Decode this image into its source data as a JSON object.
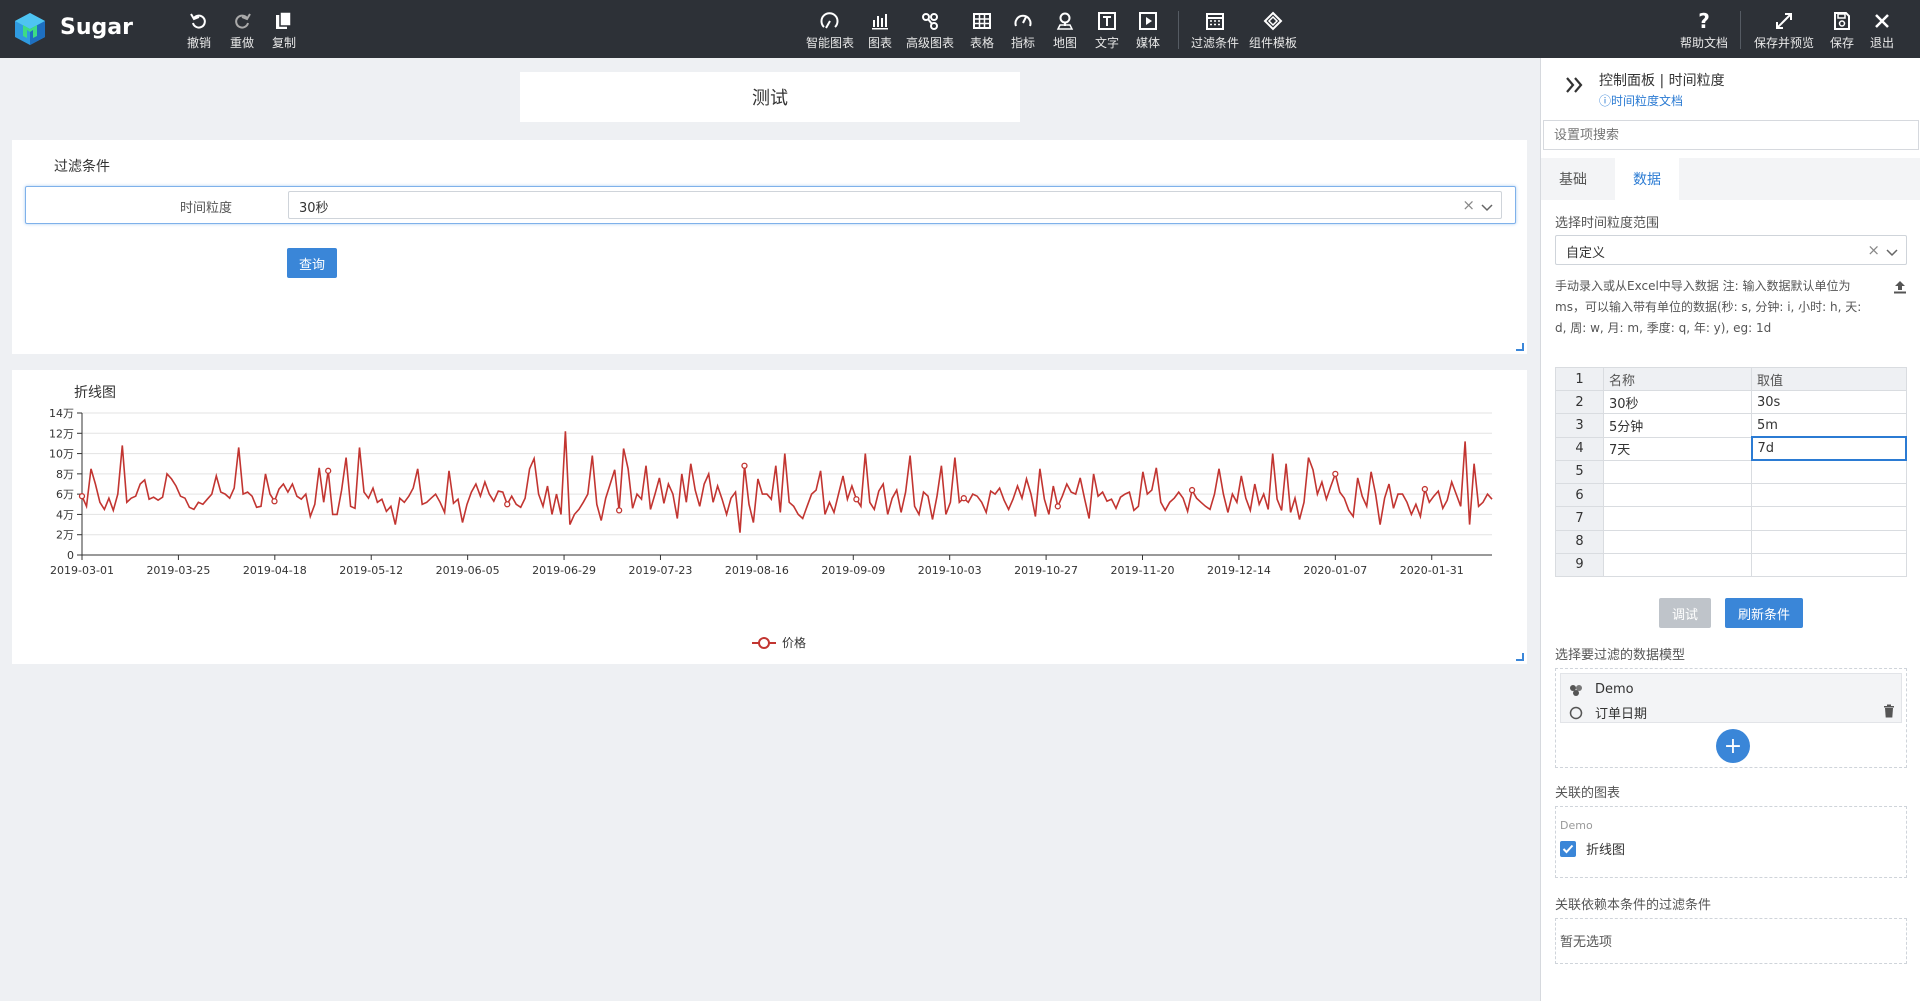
{
  "app": {
    "name": "Sugar"
  },
  "toolbar": {
    "left": [
      {
        "name": "undo",
        "label": "撤销"
      },
      {
        "name": "redo",
        "label": "重做"
      },
      {
        "name": "copy",
        "label": "复制"
      }
    ],
    "center": [
      {
        "name": "smart-chart",
        "label": "智能图表"
      },
      {
        "name": "chart",
        "label": "图表"
      },
      {
        "name": "advanced-chart",
        "label": "高级图表"
      },
      {
        "name": "table",
        "label": "表格"
      },
      {
        "name": "metric",
        "label": "指标"
      },
      {
        "name": "map",
        "label": "地图"
      },
      {
        "name": "text",
        "label": "文字"
      },
      {
        "name": "media",
        "label": "媒体"
      },
      {
        "name": "filter",
        "label": "过滤条件"
      },
      {
        "name": "component-template",
        "label": "组件模板"
      }
    ],
    "right": [
      {
        "name": "help",
        "label": "帮助文档"
      },
      {
        "name": "save-preview",
        "label": "保存并预览"
      },
      {
        "name": "save",
        "label": "保存"
      },
      {
        "name": "exit",
        "label": "退出"
      }
    ]
  },
  "canvas": {
    "title": "测试",
    "filter_card": {
      "title": "过滤条件",
      "field_label": "时间粒度",
      "field_value": "30秒",
      "clear_glyph": "×",
      "query_label": "查询"
    },
    "chart_card": {
      "title": "折线图"
    }
  },
  "chart_data": {
    "type": "line",
    "title": "折线图",
    "xlabel": "",
    "ylabel": "",
    "ylim": [
      0,
      140000
    ],
    "y_ticks": [
      0,
      20000,
      40000,
      60000,
      80000,
      100000,
      120000,
      140000
    ],
    "y_tick_labels": [
      "0",
      "2万",
      "4万",
      "6万",
      "8万",
      "10万",
      "12万",
      "14万"
    ],
    "x_tick_labels": [
      "2019-03-01",
      "2019-03-25",
      "2019-04-18",
      "2019-05-12",
      "2019-06-05",
      "2019-06-29",
      "2019-07-23",
      "2019-08-16",
      "2019-09-09",
      "2019-10-03",
      "2019-10-27",
      "2019-11-20",
      "2019-12-14",
      "2020-01-07",
      "2020-01-31"
    ],
    "x_range": [
      "2019-03-01",
      "2020-02-15"
    ],
    "grid": true,
    "legend": "bottom",
    "line_color": "#c23531",
    "series": [
      {
        "name": "价格",
        "values": [
          58000,
          48000,
          85000,
          70000,
          52000,
          45000,
          56000,
          44000,
          60000,
          108000,
          52000,
          56000,
          58000,
          70000,
          74000,
          55000,
          57000,
          54000,
          57000,
          80000,
          75000,
          68000,
          58000,
          56000,
          47000,
          45000,
          52000,
          50000,
          55000,
          60000,
          78000,
          62000,
          60000,
          56000,
          66000,
          106000,
          60000,
          62000,
          58000,
          47000,
          48000,
          80000,
          60000,
          53000,
          65000,
          70000,
          62000,
          70000,
          58000,
          55000,
          60000,
          38000,
          50000,
          86000,
          52000,
          83000,
          40000,
          40000,
          64000,
          96000,
          48000,
          46000,
          106000,
          62000,
          56000,
          66000,
          52000,
          55000,
          43000,
          48000,
          30000,
          56000,
          52000,
          58000,
          66000,
          85000,
          50000,
          52000,
          56000,
          60000,
          52000,
          42000,
          83000,
          51000,
          55000,
          32000,
          50000,
          62000,
          70000,
          58000,
          72000,
          60000,
          53000,
          63000,
          62000,
          50000,
          58000,
          50000,
          47000,
          56000,
          85000,
          95000,
          60000,
          48000,
          68000,
          40000,
          60000,
          40000,
          122000,
          30000,
          40000,
          45000,
          52000,
          60000,
          98000,
          50000,
          34000,
          56000,
          70000,
          84000,
          44000,
          105000,
          85000,
          46000,
          60000,
          55000,
          88000,
          45000,
          60000,
          76000,
          51000,
          70000,
          60000,
          36000,
          80000,
          52000,
          90000,
          64000,
          48000,
          70000,
          80000,
          52000,
          68000,
          55000,
          40000,
          56000,
          62000,
          22000,
          88000,
          50000,
          32000,
          75000,
          60000,
          60000,
          55000,
          88000,
          42000,
          100000,
          52000,
          48000,
          40000,
          36000,
          48000,
          60000,
          64000,
          83000,
          40000,
          52000,
          42000,
          60000,
          78000,
          55000,
          68000,
          55000,
          48000,
          100000,
          52000,
          45000,
          63000,
          70000,
          40000,
          56000,
          64000,
          42000,
          62000,
          98000,
          48000,
          40000,
          62000,
          58000,
          35000,
          58000,
          88000,
          40000,
          52000,
          96000,
          52000,
          56000,
          52000,
          60000,
          58000,
          52000,
          42000,
          63000,
          60000,
          66000,
          54000,
          45000,
          55000,
          68000,
          56000,
          75000,
          60000,
          38000,
          85000,
          55000,
          40000,
          68000,
          48000,
          58000,
          70000,
          62000,
          60000,
          76000,
          55000,
          36000,
          80000,
          58000,
          62000,
          53000,
          55000,
          46000,
          57000,
          60000,
          62000,
          44000,
          48000,
          82000,
          60000,
          64000,
          86000,
          52000,
          44000,
          52000,
          56000,
          62000,
          56000,
          43000,
          64000,
          56000,
          52000,
          48000,
          45000,
          60000,
          85000,
          60000,
          42000,
          60000,
          52000,
          78000,
          56000,
          44000,
          70000,
          50000,
          60000,
          45000,
          100000,
          55000,
          44000,
          90000,
          42000,
          56000,
          35000,
          52000,
          96000,
          84000,
          60000,
          72000,
          55000,
          68000,
          80000,
          62000,
          56000,
          44000,
          38000,
          76000,
          58000,
          48000,
          82000,
          60000,
          30000,
          56000,
          70000,
          46000,
          60000,
          60000,
          52000,
          40000,
          50000,
          38000,
          65000,
          52000,
          58000,
          63000,
          46000,
          54000,
          72000,
          60000,
          48000,
          112000,
          30000,
          90000,
          48000,
          52000,
          60000,
          55000
        ]
      }
    ]
  },
  "panel": {
    "header_title": "控制面板 | 时间粒度",
    "doc_link": "ⓘ时间粒度文档",
    "search_placeholder": "设置项搜索",
    "tabs": [
      {
        "label": "基础"
      },
      {
        "label": "数据"
      }
    ],
    "range_label": "选择时间粒度范围",
    "range_value": "自定义",
    "clear_glyph": "×",
    "description": "手动录入或从Excel中导入数据 注: 输入数据默认单位为ms，可以输入带有单位的数据(秒: s, 分钟: i, 小时: h, 天: d, 周: w, 月: m, 季度: q, 年: y), eg: 1d",
    "grid": {
      "rows": [
        {
          "num": "1",
          "name": "名称",
          "value": "取值"
        },
        {
          "num": "2",
          "name": "30秒",
          "value": "30s"
        },
        {
          "num": "3",
          "name": "5分钟",
          "value": "5m"
        },
        {
          "num": "4",
          "name": "7天",
          "value": "7d"
        },
        {
          "num": "5",
          "name": "",
          "value": ""
        },
        {
          "num": "6",
          "name": "",
          "value": ""
        },
        {
          "num": "7",
          "name": "",
          "value": ""
        },
        {
          "num": "8",
          "name": "",
          "value": ""
        },
        {
          "num": "9",
          "name": "",
          "value": ""
        }
      ]
    },
    "debug_label": "调试",
    "refresh_label": "刷新条件",
    "model_section_label": "选择要过滤的数据模型",
    "model_name": "Demo",
    "model_field": "订单日期",
    "add_glyph": "+",
    "related_label": "关联的图表",
    "related_group": "Demo",
    "related_chart": "折线图",
    "depends_label": "关联依赖本条件的过滤条件",
    "depends_empty": "暂无选项"
  },
  "colors": {
    "accent": "#3a86d8",
    "topbar": "#2d3137",
    "line": "#c23531"
  }
}
